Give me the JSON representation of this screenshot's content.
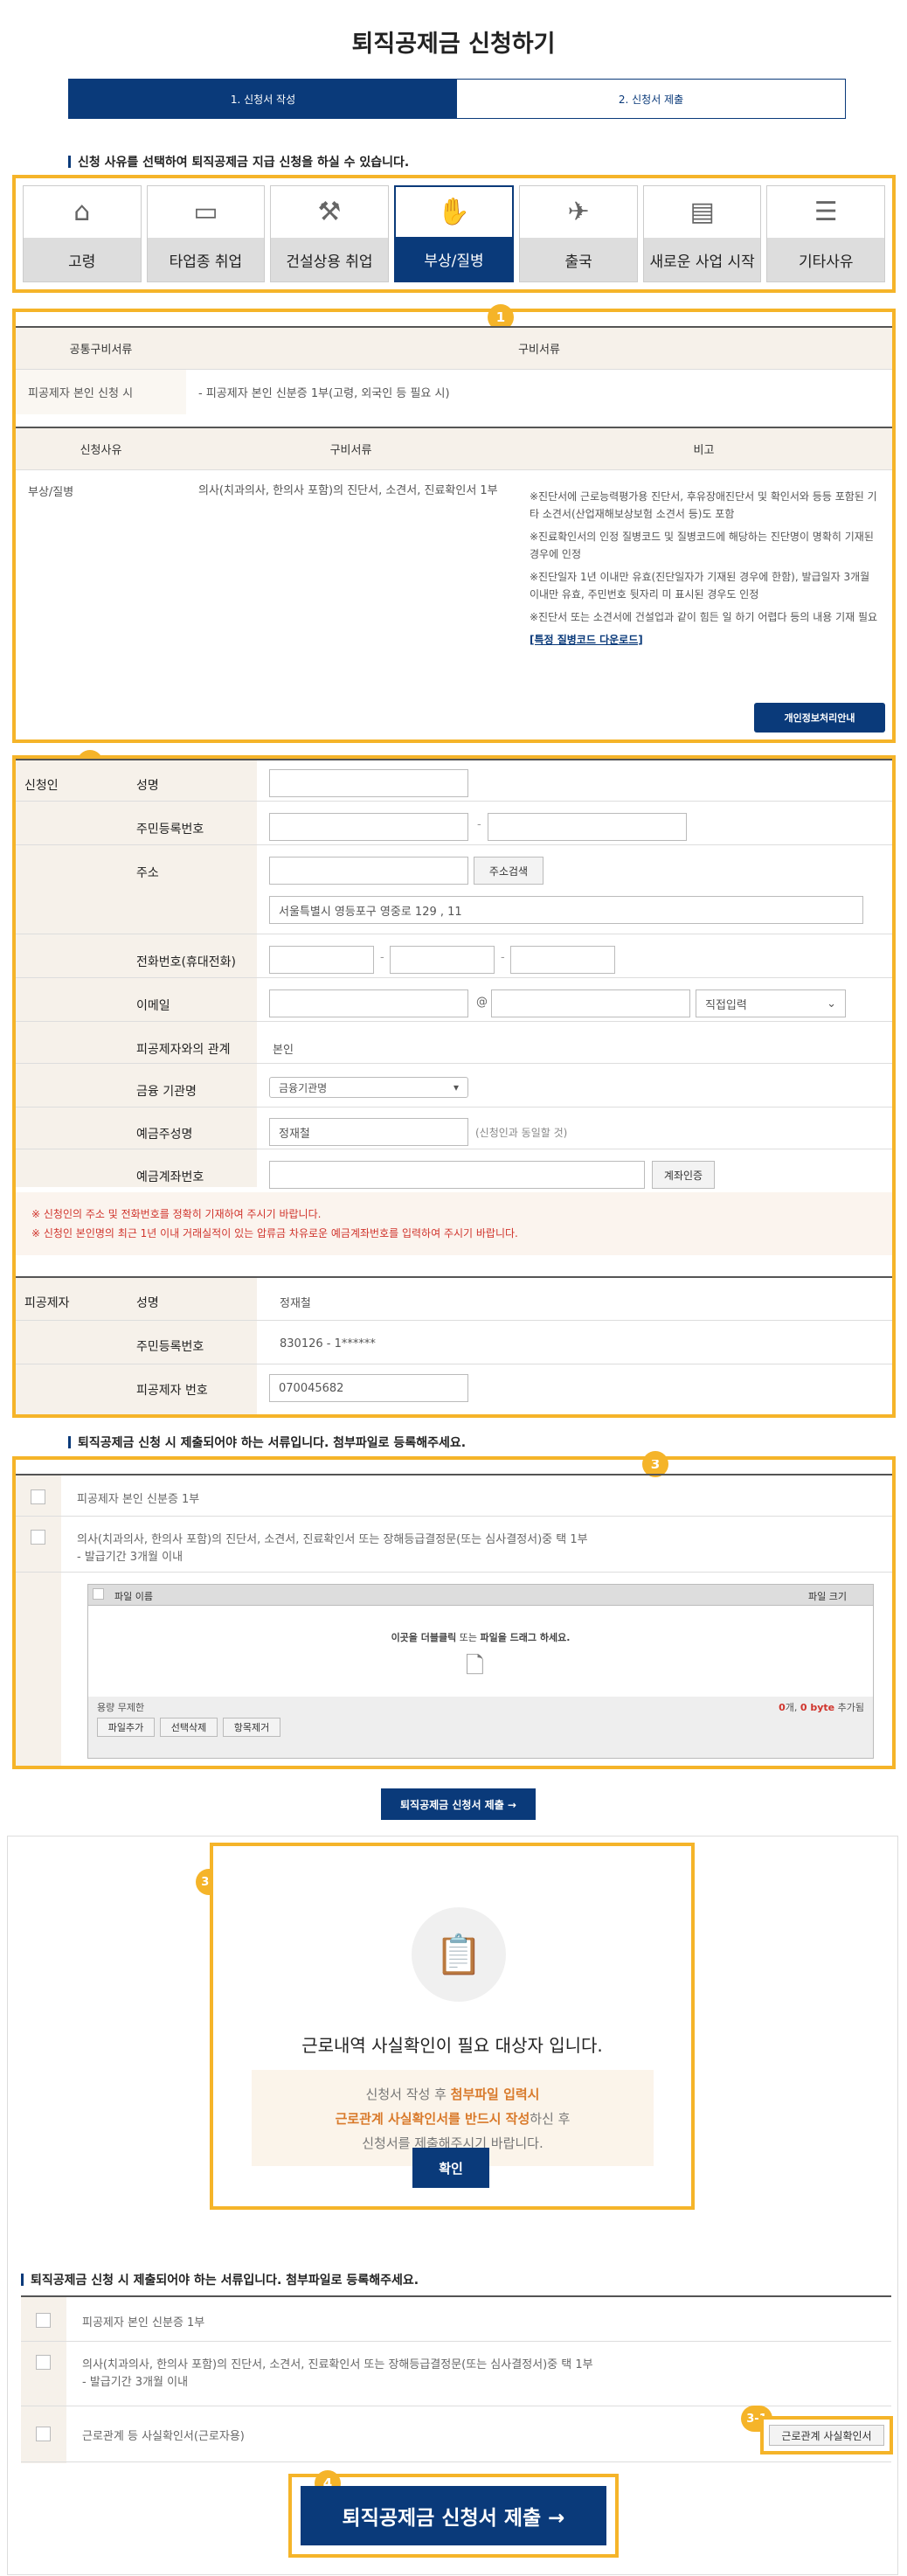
{
  "title": "퇴직공제금 신청하기",
  "steps": [
    "1. 신청서 작성",
    "2. 신청서 제출"
  ],
  "intro": "신청 사유를 선택하여 퇴직공제금 지급 신청을 하실 수 있습니다.",
  "categories": [
    {
      "label": "고령",
      "icon": "house-person-icon"
    },
    {
      "label": "타업종 취업",
      "icon": "briefcase-icon"
    },
    {
      "label": "건설상용 취업",
      "icon": "excavator-icon"
    },
    {
      "label": "부상/질병",
      "icon": "bandaged-arm-icon"
    },
    {
      "label": "출국",
      "icon": "airplane-icon"
    },
    {
      "label": "새로운 사업 시작",
      "icon": "presentation-board-icon"
    },
    {
      "label": "기타사유",
      "icon": "list-icon"
    }
  ],
  "common_docs": {
    "col1": "공통구비서류",
    "col2": "구비서류",
    "row_label": "피공제자 본인 신청 시",
    "row_value": "- 피공제자 본인 신분증 1부(고령, 외국인 등 필요 시)"
  },
  "reason_docs": {
    "col1": "신청사유",
    "col2": "구비서류",
    "col3": "비고",
    "reason": "부상/질병",
    "docs": "의사(치과의사, 한의사 포함)의 진단서, 소견서, 진료확인서 1부",
    "notes": [
      "※진단서에 근로능력평가용 진단서, 후유장애진단서 및 확인서와 등등 포함된 기타 소견서(산업재해보상보험 소견서 등)도 포함",
      "※진료확인서의 인정 질병코드 및 질병코드에 해당하는 진단명이 명확히 기재된 경우에 인정",
      "※진단일자 1년 이내만 유효(진단일자가 기재된 경우에 한함), 발급일자 3개월 이내만 유효, 주민번호 뒷자리 미 표시된 경우도 인정",
      "※진단서 또는 소견서에 건설업과 같이 힘든 일 하기 어렵다 등의 내용 기재 필요"
    ],
    "link": "[특정 질병코드 다운로드]"
  },
  "privacy_btn": "개인정보처리안내",
  "applicant": {
    "section": "신청인",
    "name": "성명",
    "rrn": "주민등록번호",
    "address": "주소",
    "addr_search": "주소검색",
    "addr_value": "서울특별시 영등포구 영중로 129 , 11",
    "phone": "전화번호(휴대전화)",
    "email": "이메일",
    "email_at": "@",
    "email_select": "직접입력",
    "relation": "피공제자와의 관계",
    "relation_value": "본인",
    "bank": "금융 기관명",
    "bank_select": "금융기관명",
    "depositor": "예금주성명",
    "depositor_value": "정재철",
    "depositor_note": "(신청인과 동일할 것)",
    "account": "예금계좌번호",
    "verify": "계좌인증",
    "warn1": "※ 신청인의 주소 및 전화번호를 정확히 기재하여 주시기 바랍니다.",
    "warn2": "※ 신청인 본인명의 최근 1년 이내 거래실적이 있는 압류금 차유로운 예금계좌번호를 입력하여 주시기 바랍니다."
  },
  "insured": {
    "section": "피공제자",
    "name": "성명",
    "name_value": "정재철",
    "rrn": "주민등록번호",
    "rrn_value": "830126 - 1******",
    "no": "피공제자 번호",
    "no_value": "070045682"
  },
  "attach_head": "퇴직공제금 신청 시 제출되어야 하는 서류입니다. 첨부파일로 등록해주세요.",
  "attach_items": [
    "피공제자 본인 신분증 1부",
    "의사(치과의사, 한의사 포함)의 진단서, 소견서, 진료확인서 또는 장해등급결정문(또는 심사결정서)중 택 1부",
    "- 발급기간 3개월 이내"
  ],
  "uploader": {
    "name_col": "파일 이름",
    "size_col": "파일 크기",
    "drop_pre": "이곳을 ",
    "drop_click": "더블클릭",
    "drop_mid": " 또는 ",
    "drop_file": "파일을 드래그",
    "drop_post": " 하세요.",
    "limit": "용량 무제한",
    "count": "0",
    "count_unit": "개, ",
    "bytes": "0 byte",
    "bytes_suffix": " 추가됨",
    "add": "파일추가",
    "sel_del": "선택삭제",
    "all_del": "항목제거"
  },
  "submit_small": "퇴직공제금 신청서 제출 →",
  "modal": {
    "title": "근로내역 사실확인이 필요 대상자 입니다.",
    "l1": "신청서 작성 후 ",
    "l1b": "첨부파일 입력시",
    "l2b": "근로관계 사실확인서를 반드시 작성",
    "l2": "하신 후",
    "l3": "신청서를 제출해주시기 바랍니다.",
    "ok": "확인"
  },
  "attach2": {
    "head": "퇴직공제금 신청 시 제출되어야 하는 서류입니다. 첨부파일로 등록해주세요.",
    "i1": "피공제자 본인 신분증 1부",
    "i2": "의사(치과의사, 한의사 포함)의 진단서, 소견서, 진료확인서 또는 장해등급결정문(또는 심사결정서)중 택 1부",
    "i2b": "- 발급기간 3개월 이내",
    "i3": "근로관계 등 사실확인서(근로자용)",
    "btn": "근로관계 사실확인서"
  },
  "submit_big": "퇴직공제금 신청서 제출  →",
  "badges": [
    "1",
    "2",
    "3",
    "3-1",
    "3-1",
    "4"
  ]
}
